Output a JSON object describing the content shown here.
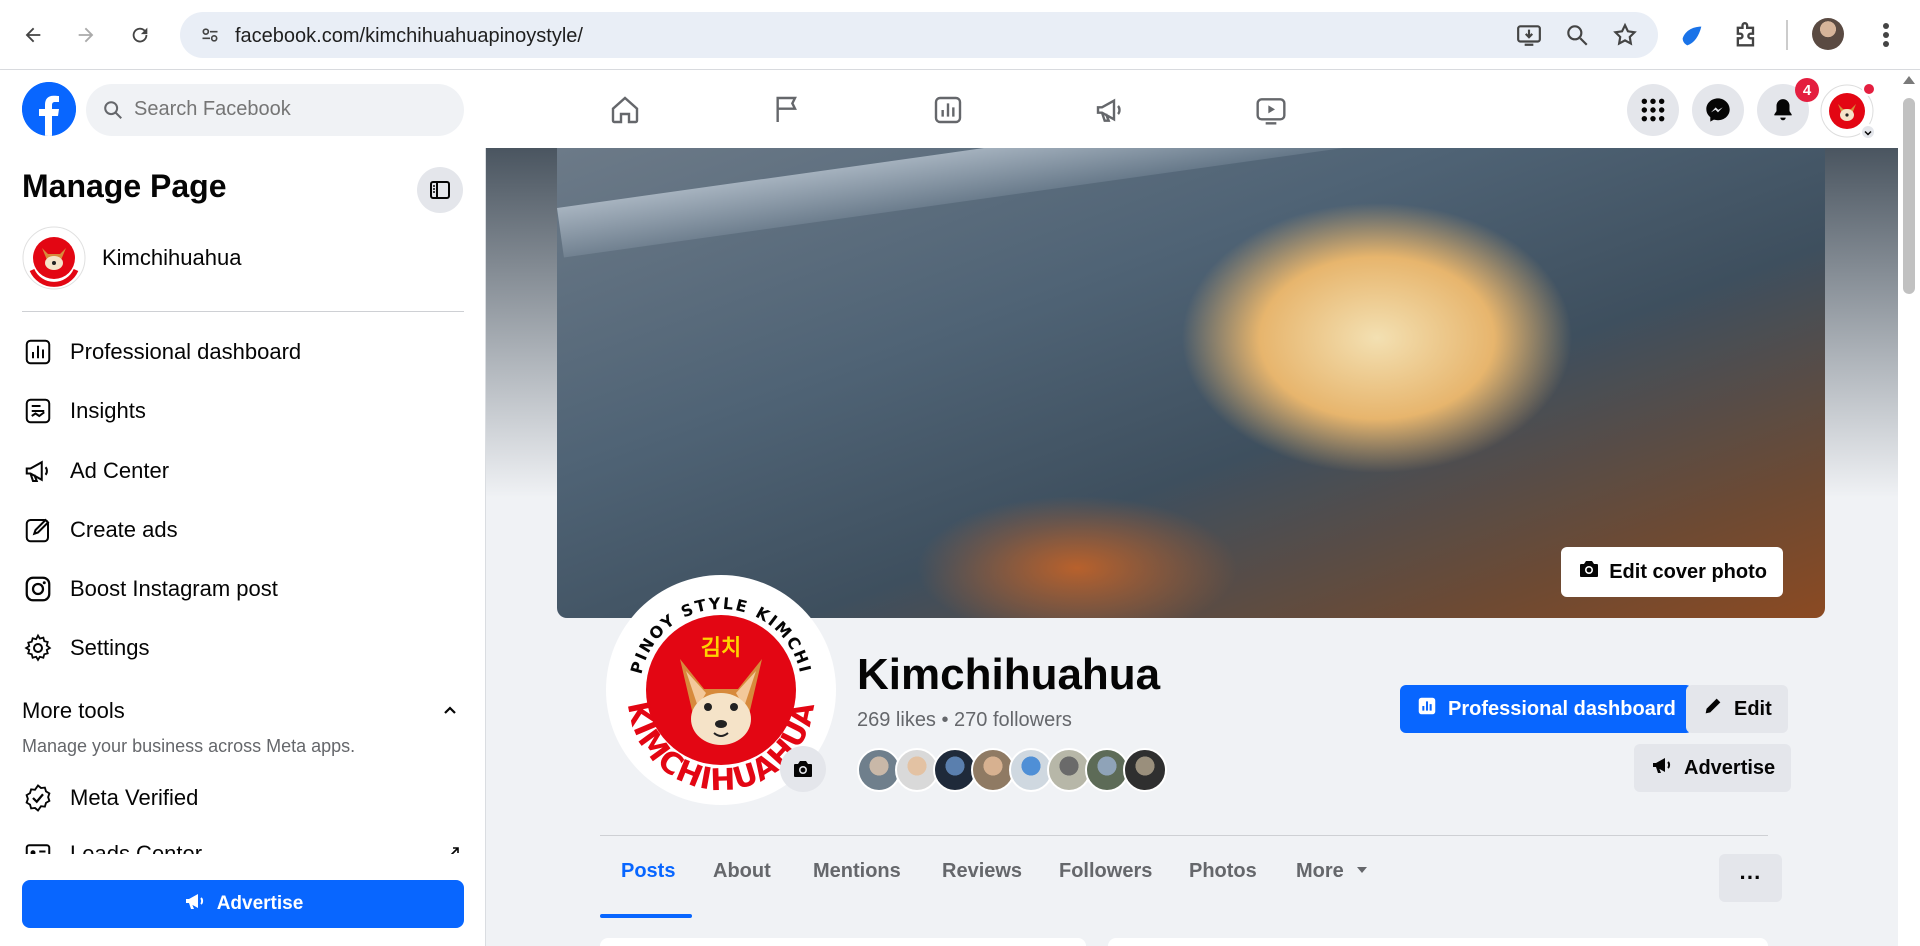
{
  "browser": {
    "url": "facebook.com/kimchihuahuapinoystyle/"
  },
  "header": {
    "search_placeholder": "Search Facebook",
    "notification_count": "4",
    "nav_icons": [
      "home-icon",
      "flag-icon",
      "insights-icon",
      "megaphone-icon",
      "video-icon"
    ]
  },
  "sidebar": {
    "title": "Manage Page",
    "page_name": "Kimchihuahua",
    "items": [
      {
        "label": "Professional dashboard",
        "icon": "dashboard-icon"
      },
      {
        "label": "Insights",
        "icon": "insights-icon"
      },
      {
        "label": "Ad Center",
        "icon": "megaphone-icon"
      },
      {
        "label": "Create ads",
        "icon": "pencil-icon"
      },
      {
        "label": "Boost Instagram post",
        "icon": "instagram-icon"
      },
      {
        "label": "Settings",
        "icon": "gear-icon"
      }
    ],
    "more_tools": {
      "title": "More tools",
      "subtitle": "Manage your business across Meta apps.",
      "items": [
        {
          "label": "Meta Verified",
          "icon": "verified-icon"
        },
        {
          "label": "Leads Center",
          "icon": "id-card-icon"
        }
      ]
    },
    "advertise_label": "Advertise"
  },
  "profile": {
    "name": "Kimchihuahua",
    "stats": "269 likes • 270 followers",
    "edit_cover_label": "Edit cover photo",
    "logo_top_text": "PINOY STYLE KIMCHI",
    "logo_korean": "김치",
    "logo_bottom_text": "KIMCHIHUAHUA",
    "buttons": {
      "dashboard": "Professional dashboard",
      "edit": "Edit",
      "advertise": "Advertise"
    }
  },
  "tabs": [
    "Posts",
    "About",
    "Mentions",
    "Reviews",
    "Followers",
    "Photos",
    "More"
  ],
  "more_menu_label": "···",
  "colors": {
    "facebook_blue": "#0866ff",
    "notification_red": "#e41e3f",
    "logo_red": "#e30613"
  }
}
